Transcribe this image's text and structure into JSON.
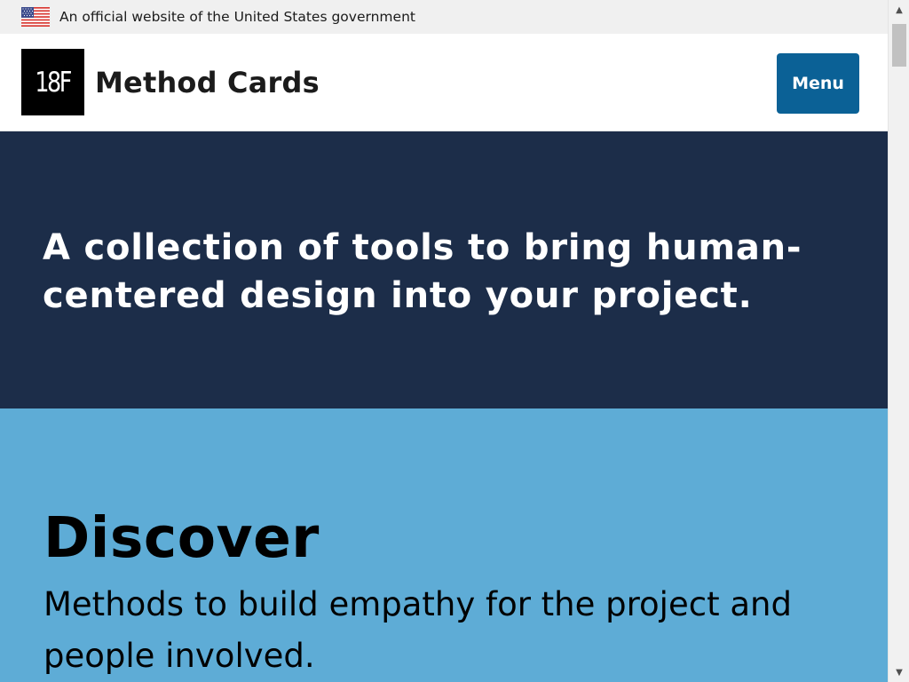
{
  "gov_banner": {
    "flag_icon": "us-flag-icon",
    "text": "An official website of the United States government"
  },
  "header": {
    "logo_text": "18F",
    "site_title": "Method Cards",
    "menu_label": "Menu"
  },
  "hero": {
    "tagline": "A collection of tools to bring human-centered design into your project."
  },
  "discover": {
    "title": "Discover",
    "description": "Methods to build empathy for the project and people involved."
  },
  "scrollbar": {
    "up_icon": "scroll-up-arrow-icon",
    "down_icon": "scroll-down-arrow-icon"
  },
  "colors": {
    "banner_bg": "#f0f0f0",
    "hero_bg": "#1c2d49",
    "discover_bg": "#5eacd6",
    "menu_button_bg": "#0b6196",
    "logo_bg": "#000000"
  }
}
